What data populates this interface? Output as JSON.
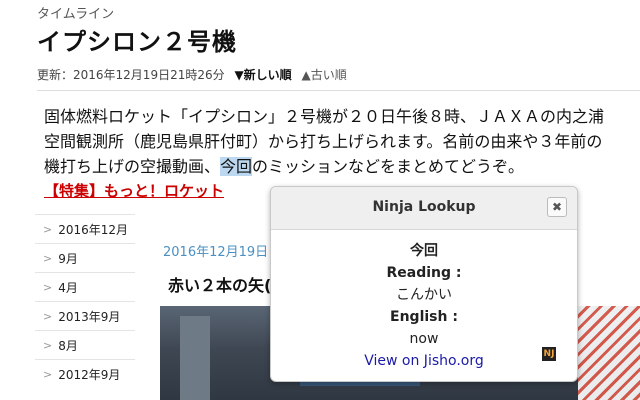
{
  "header": {
    "category": "タイムライン",
    "title": "イプシロン２号機",
    "updated": "更新：2016年12月19日21時26分",
    "sort_new": "▼新しい順",
    "sort_old": "▲古い順"
  },
  "article_intro": {
    "line1": "固体燃料ロケット「イプシロン」２号機が２０日午後８時、ＪＡＸＡの内之浦",
    "line2": "空間観測所（鹿児島県肝付町）から打ち上げられます。名前の由来や３年前の",
    "line3_before": "機打ち上げの空撮動画、",
    "line3_highlight": "今回",
    "line3_after": "のミッションなどをまとめてどうぞ。",
    "feature_link": "【特集】もっと！ロケット"
  },
  "sidebar": {
    "items": [
      {
        "label": "2016年12月"
      },
      {
        "label": "9月"
      },
      {
        "label": "4月"
      },
      {
        "label": "2013年9月"
      },
      {
        "label": "8月"
      },
      {
        "label": "2012年9月"
      }
    ]
  },
  "article": {
    "date": "2016年12月19日",
    "title": "赤い２本の矢("
  },
  "popup": {
    "title": "Ninja Lookup",
    "close": "✖",
    "word": "今回",
    "reading_label": "Reading :",
    "reading": "こんかい",
    "english_label": "English :",
    "english": "now",
    "link": "View on Jisho.org",
    "icon_text": "NJ"
  }
}
